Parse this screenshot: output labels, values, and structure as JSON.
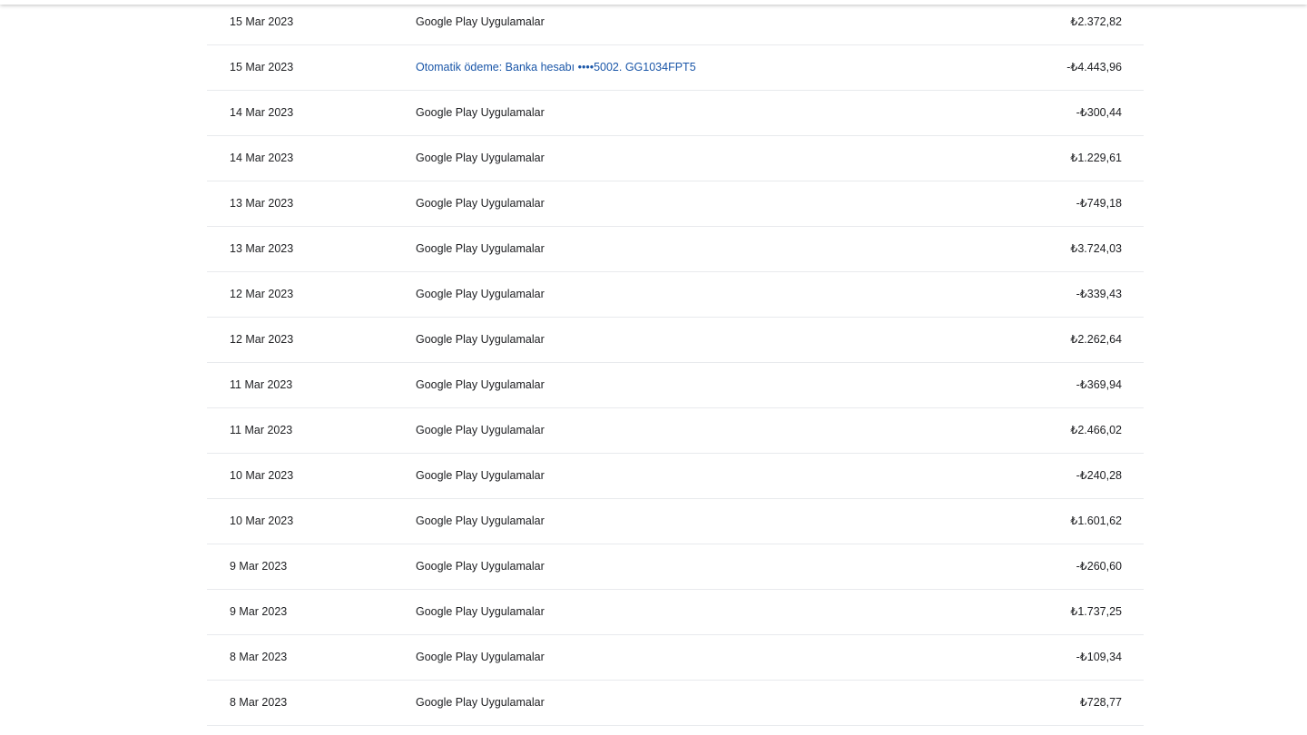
{
  "transactions": [
    {
      "date": "15 Mar 2023",
      "description": "Google Play Uygulamalar",
      "amount": "₺2.372,82",
      "link": false
    },
    {
      "date": "15 Mar 2023",
      "description": "Otomatik ödeme: Banka hesabı  ••••5002. GG1034FPT5",
      "amount": "-₺4.443,96",
      "link": true
    },
    {
      "date": "14 Mar 2023",
      "description": "Google Play Uygulamalar",
      "amount": "-₺300,44",
      "link": false
    },
    {
      "date": "14 Mar 2023",
      "description": "Google Play Uygulamalar",
      "amount": "₺1.229,61",
      "link": false
    },
    {
      "date": "13 Mar 2023",
      "description": "Google Play Uygulamalar",
      "amount": "-₺749,18",
      "link": false
    },
    {
      "date": "13 Mar 2023",
      "description": "Google Play Uygulamalar",
      "amount": "₺3.724,03",
      "link": false
    },
    {
      "date": "12 Mar 2023",
      "description": "Google Play Uygulamalar",
      "amount": "-₺339,43",
      "link": false
    },
    {
      "date": "12 Mar 2023",
      "description": "Google Play Uygulamalar",
      "amount": "₺2.262,64",
      "link": false
    },
    {
      "date": "11 Mar 2023",
      "description": "Google Play Uygulamalar",
      "amount": "-₺369,94",
      "link": false
    },
    {
      "date": "11 Mar 2023",
      "description": "Google Play Uygulamalar",
      "amount": "₺2.466,02",
      "link": false
    },
    {
      "date": "10 Mar 2023",
      "description": "Google Play Uygulamalar",
      "amount": "-₺240,28",
      "link": false
    },
    {
      "date": "10 Mar 2023",
      "description": "Google Play Uygulamalar",
      "amount": "₺1.601,62",
      "link": false
    },
    {
      "date": "9 Mar 2023",
      "description": "Google Play Uygulamalar",
      "amount": "-₺260,60",
      "link": false
    },
    {
      "date": "9 Mar 2023",
      "description": "Google Play Uygulamalar",
      "amount": "₺1.737,25",
      "link": false
    },
    {
      "date": "8 Mar 2023",
      "description": "Google Play Uygulamalar",
      "amount": "-₺109,34",
      "link": false
    },
    {
      "date": "8 Mar 2023",
      "description": "Google Play Uygulamalar",
      "amount": "₺728,77",
      "link": false
    }
  ]
}
